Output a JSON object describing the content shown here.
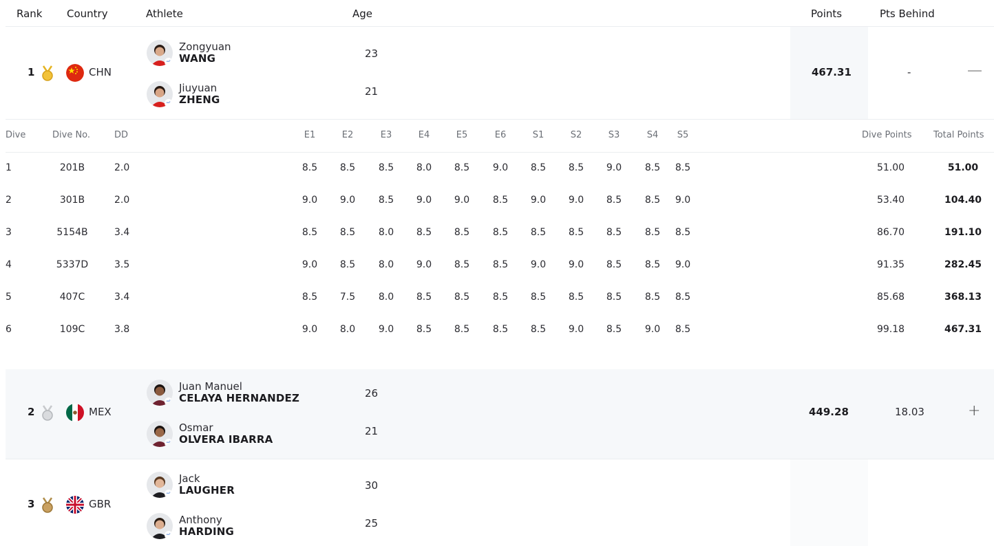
{
  "headers": {
    "rank": "Rank",
    "country": "Country",
    "athlete": "Athlete",
    "age": "Age",
    "points": "Points",
    "pts_behind": "Pts Behind"
  },
  "dive_headers": {
    "dive": "Dive",
    "dive_no": "Dive No.",
    "dd": "DD",
    "judges": [
      "E1",
      "E2",
      "E3",
      "E4",
      "E5",
      "E6",
      "S1",
      "S2",
      "S3",
      "S4",
      "S5"
    ],
    "dive_points": "Dive Points",
    "total_points": "Total Points"
  },
  "teams": [
    {
      "rank": "1",
      "medal": "gold-medal-icon",
      "medal_color": "#e6b422",
      "flag": "china-flag-icon",
      "country": "CHN",
      "athletes": [
        {
          "first": "Zongyuan",
          "last": "WANG",
          "age": "23"
        },
        {
          "first": "Jiuyuan",
          "last": "ZHENG",
          "age": "21"
        }
      ],
      "points": "467.31",
      "pts_behind": "-",
      "toggle": "—"
    },
    {
      "rank": "2",
      "medal": "silver-medal-icon",
      "medal_color": "#c7c9cc",
      "flag": "mexico-flag-icon",
      "country": "MEX",
      "athletes": [
        {
          "first": "Juan Manuel",
          "last": "CELAYA HERNANDEZ",
          "age": "26"
        },
        {
          "first": "Osmar",
          "last": "OLVERA IBARRA",
          "age": "21"
        }
      ],
      "points": "449.28",
      "pts_behind": "18.03",
      "toggle": "+"
    },
    {
      "rank": "3",
      "medal": "bronze-medal-icon",
      "medal_color": "#b08d4a",
      "flag": "uk-flag-icon",
      "country": "GBR",
      "athletes": [
        {
          "first": "Jack",
          "last": "LAUGHER",
          "age": "30"
        },
        {
          "first": "Anthony",
          "last": "HARDING",
          "age": "25"
        }
      ],
      "points": "",
      "pts_behind": "",
      "toggle": ""
    }
  ],
  "dives": [
    {
      "dive": "1",
      "no": "201B",
      "dd": "2.0",
      "scores": [
        "8.5",
        "8.5",
        "8.5",
        "8.0",
        "8.5",
        "9.0",
        "8.5",
        "8.5",
        "9.0",
        "8.5",
        "8.5"
      ],
      "dive_points": "51.00",
      "total": "51.00"
    },
    {
      "dive": "2",
      "no": "301B",
      "dd": "2.0",
      "scores": [
        "9.0",
        "9.0",
        "8.5",
        "9.0",
        "9.0",
        "8.5",
        "9.0",
        "9.0",
        "8.5",
        "8.5",
        "9.0"
      ],
      "dive_points": "53.40",
      "total": "104.40"
    },
    {
      "dive": "3",
      "no": "5154B",
      "dd": "3.4",
      "scores": [
        "8.5",
        "8.5",
        "8.0",
        "8.5",
        "8.5",
        "8.5",
        "8.5",
        "8.5",
        "8.5",
        "8.5",
        "8.5"
      ],
      "dive_points": "86.70",
      "total": "191.10"
    },
    {
      "dive": "4",
      "no": "5337D",
      "dd": "3.5",
      "scores": [
        "9.0",
        "8.5",
        "8.0",
        "9.0",
        "8.5",
        "8.5",
        "9.0",
        "9.0",
        "8.5",
        "8.5",
        "9.0"
      ],
      "dive_points": "91.35",
      "total": "282.45"
    },
    {
      "dive": "5",
      "no": "407C",
      "dd": "3.4",
      "scores": [
        "8.5",
        "7.5",
        "8.0",
        "8.5",
        "8.5",
        "8.5",
        "8.5",
        "8.5",
        "8.5",
        "8.5",
        "8.5"
      ],
      "dive_points": "85.68",
      "total": "368.13"
    },
    {
      "dive": "6",
      "no": "109C",
      "dd": "3.8",
      "scores": [
        "9.0",
        "8.0",
        "9.0",
        "8.5",
        "8.5",
        "8.5",
        "8.5",
        "9.0",
        "8.5",
        "9.0",
        "8.5"
      ],
      "dive_points": "99.18",
      "total": "467.31"
    }
  ]
}
